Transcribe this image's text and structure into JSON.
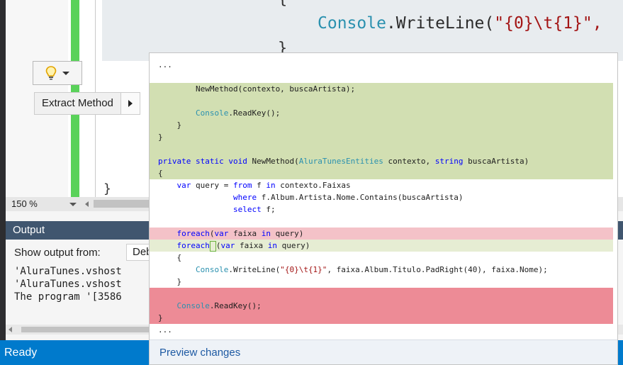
{
  "editor": {
    "console_line_prefix": "Console",
    "console_line_method": ".WriteLine(",
    "console_line_string": "\"{0}\\t{1}\",",
    "brace_open": "{",
    "brace_close": "}",
    "brace_small": "}"
  },
  "lightbulb": {
    "icon": "lightbulb-icon"
  },
  "quick_action": {
    "label": "Extract Method"
  },
  "zoom": {
    "value": "150 %"
  },
  "output": {
    "title": "Output",
    "show_from_label": "Show output from:",
    "show_from_value": "Deb",
    "lines": [
      "'AluraTunes.vshost",
      "'AluraTunes.vshost",
      "The program '[3586"
    ]
  },
  "status": {
    "text": "Ready"
  },
  "preview": {
    "footer_link": "Preview changes",
    "lines": [
      {
        "style": "plain",
        "text": "..."
      },
      {
        "style": "plain",
        "text": ""
      },
      {
        "style": "green",
        "text": "        NewMethod(contexto, buscaArtista);"
      },
      {
        "style": "green",
        "text": ""
      },
      {
        "style": "green",
        "text": "        Console.ReadKey();"
      },
      {
        "style": "green",
        "text": "    }"
      },
      {
        "style": "green",
        "text": "}"
      },
      {
        "style": "green",
        "text": ""
      },
      {
        "style": "green",
        "text": "private static void NewMethod(AluraTunesEntities contexto, string buscaArtista)"
      },
      {
        "style": "green",
        "text": "{"
      },
      {
        "style": "plain",
        "text": "    var query = from f in contexto.Faixas"
      },
      {
        "style": "plain",
        "text": "                where f.Album.Artista.Nome.Contains(buscaArtista)"
      },
      {
        "style": "plain",
        "text": "                select f;"
      },
      {
        "style": "plain",
        "text": ""
      },
      {
        "style": "pink",
        "text": "    foreach(var faixa in query)"
      },
      {
        "style": "green-light",
        "text": "    foreach (var faixa in query)"
      },
      {
        "style": "plain",
        "text": "    {"
      },
      {
        "style": "plain",
        "text": "        Console.WriteLine(\"{0}\\t{1}\", faixa.Album.Titulo.PadRight(40), faixa.Nome);"
      },
      {
        "style": "plain",
        "text": "    }"
      },
      {
        "style": "red",
        "text": ""
      },
      {
        "style": "red",
        "text": "    Console.ReadKey();"
      },
      {
        "style": "red",
        "text": "}"
      },
      {
        "style": "plain",
        "text": "..."
      }
    ]
  }
}
